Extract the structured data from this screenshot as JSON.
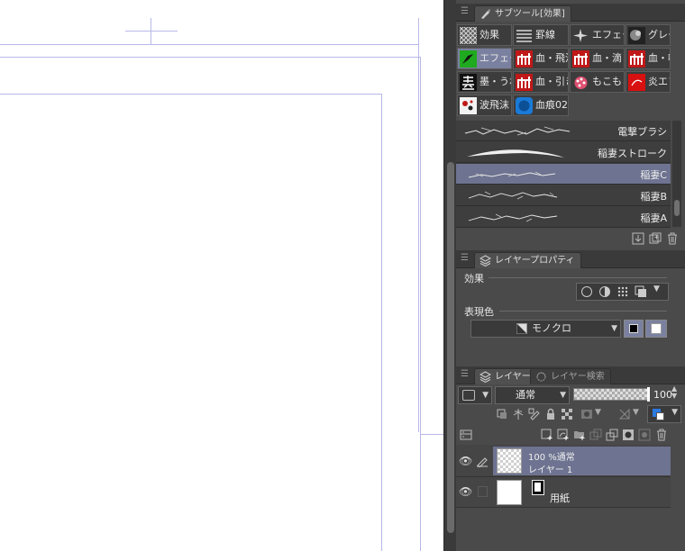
{
  "subtool_panel": {
    "tab_label": "サブツール[効果]",
    "groups": [
      {
        "label": "効果",
        "icon": "crosshatch-icon"
      },
      {
        "label": "罫線",
        "icon": "lines-icon"
      },
      {
        "label": "エフェク",
        "icon": "sparkle-icon"
      },
      {
        "label": "グレー",
        "icon": "gray-texture-icon"
      },
      {
        "label": "エフェク",
        "icon": "effect-green-icon",
        "selected": true
      },
      {
        "label": "血・飛沫",
        "icon": "blood-splash-icon"
      },
      {
        "label": "血・滴",
        "icon": "blood-drip-icon"
      },
      {
        "label": "血・噴",
        "icon": "blood-spray-icon"
      },
      {
        "label": "墨・うね",
        "icon": "ink-kanji-icon"
      },
      {
        "label": "血・引き",
        "icon": "blood-drag-icon"
      },
      {
        "label": "もこもこ",
        "icon": "fluffy-icon"
      },
      {
        "label": "炎エフェ",
        "icon": "flame-icon"
      },
      {
        "label": "波飛沫",
        "icon": "wave-splash-icon"
      },
      {
        "label": "血痕02",
        "icon": "bloodstain-icon"
      }
    ],
    "brushes": [
      {
        "name": "電撃ブラシ"
      },
      {
        "name": "稲妻ストローク"
      },
      {
        "name": "稲妻C",
        "selected": true
      },
      {
        "name": "稲妻B"
      },
      {
        "name": "稲妻A"
      }
    ]
  },
  "layer_property_panel": {
    "tab_label": "レイヤープロパティ",
    "effect_label": "効果",
    "expression_color_label": "表現色",
    "expression_color_value": "モノクロ"
  },
  "layer_panel": {
    "tab_label": "レイヤー",
    "tab2_label": "レイヤー検索",
    "blend_mode": "通常",
    "opacity": "100",
    "layers": [
      {
        "opacity_blend": "100 %通常",
        "name": "レイヤー 1",
        "selected": true
      },
      {
        "name": "用紙"
      }
    ]
  }
}
